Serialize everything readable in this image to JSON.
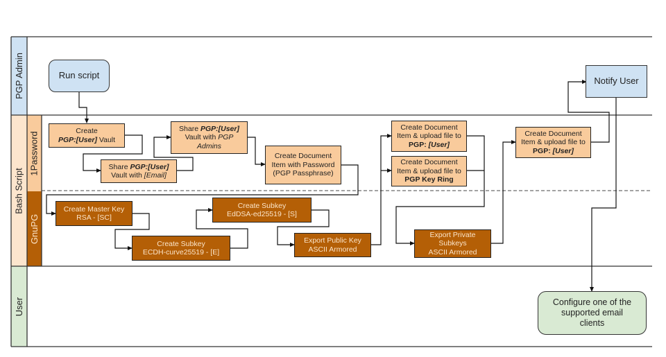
{
  "diagram": {
    "type": "swimlane-flowchart",
    "lanes": [
      {
        "id": "pgp-admin",
        "label": "PGP Admin",
        "color": "#cfe2f3"
      },
      {
        "id": "bash-script",
        "label": "Bash Script",
        "color": "#fce5cd",
        "sublanes": [
          {
            "id": "1password",
            "label": "1Password",
            "color": "#f9cb9c"
          },
          {
            "id": "gnupg",
            "label": "GnuPG",
            "color": "#b45f06"
          }
        ]
      },
      {
        "id": "user",
        "label": "User",
        "color": "#d9ead3"
      }
    ],
    "nodes": {
      "run_script": {
        "text": "Run script"
      },
      "notify_user": {
        "text": "Notify User"
      },
      "create_vault": {
        "line1": "Create",
        "line2_bold_italic": "PGP:[User]",
        "line2_rest": " Vault"
      },
      "share_vault_email": {
        "line1_plain": "Share ",
        "line1_bold_italic": "PGP:[User]",
        "line2_plain": "Vault with ",
        "line2_italic": "[Email]"
      },
      "share_vault_admins": {
        "line1_plain": "Share ",
        "line1_bold_italic": "PGP:[User]",
        "line2_plain": "Vault with ",
        "line2_italic": "PGP Admins"
      },
      "create_doc_password": {
        "text": "Create Document Item with Password (PGP Passphrase)"
      },
      "upload_user_1": {
        "text_plain": "Create Document Item & upload file to ",
        "bold": "PGP: ",
        "bold_italic": "[User]"
      },
      "upload_keyring": {
        "text_plain": "Create Document Item & upload file to ",
        "bold": "PGP Key Ring"
      },
      "upload_user_2": {
        "text_plain": "Create Document Item & upload file to ",
        "bold": "PGP: ",
        "bold_italic": "[User]"
      },
      "master_key": {
        "line1": "Create Master Key",
        "line2": "RSA - [SC]"
      },
      "subkey_e": {
        "line1": "Create Subkey",
        "line2": "ECDH-curve25519 - [E]"
      },
      "subkey_s": {
        "line1": "Create Subkey",
        "line2": "EdDSA-ed25519 - [S]"
      },
      "export_public": {
        "line1": "Export Public Key",
        "line2": "ASCII Armored"
      },
      "export_private": {
        "line1": "Export Private",
        "line2": "Subkeys",
        "line3": "ASCII Armored"
      },
      "configure_client": {
        "text": "Configure one of the supported email clients"
      }
    },
    "edges": [
      [
        "run_script",
        "create_vault"
      ],
      [
        "create_vault",
        "share_vault_email"
      ],
      [
        "share_vault_email",
        "share_vault_admins"
      ],
      [
        "share_vault_admins",
        "create_doc_password"
      ],
      [
        "create_doc_password",
        "master_key"
      ],
      [
        "master_key",
        "subkey_e"
      ],
      [
        "subkey_e",
        "subkey_s"
      ],
      [
        "subkey_s",
        "export_public"
      ],
      [
        "export_public",
        "upload_user_1"
      ],
      [
        "export_public",
        "upload_keyring"
      ],
      [
        "upload_user_1",
        "export_private"
      ],
      [
        "upload_keyring",
        "export_private"
      ],
      [
        "export_private",
        "upload_user_2"
      ],
      [
        "upload_user_2",
        "notify_user"
      ],
      [
        "notify_user",
        "configure_client"
      ]
    ]
  }
}
